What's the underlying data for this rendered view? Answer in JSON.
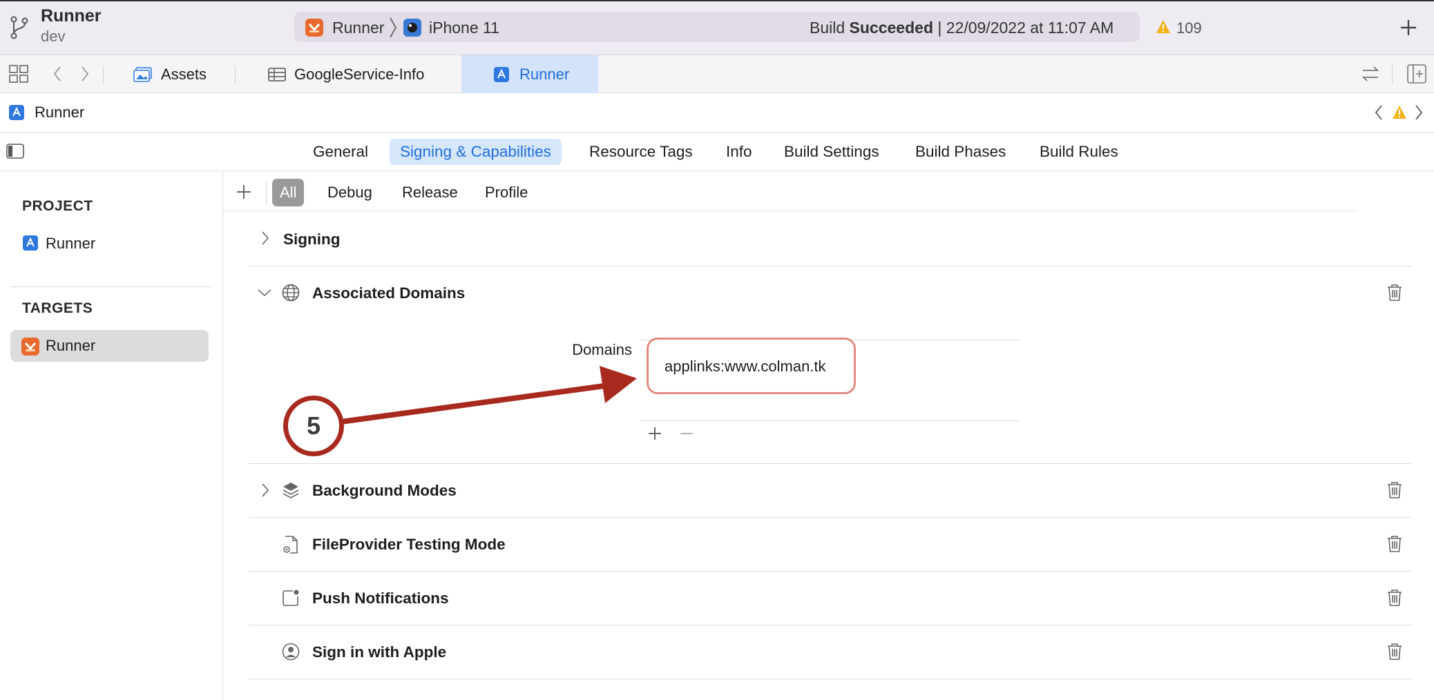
{
  "toolbar": {
    "project_name": "Runner",
    "branch": "dev",
    "scheme": "Runner",
    "device": "iPhone 11",
    "build_prefix": "Build",
    "build_status": "Succeeded",
    "build_time": "| 22/09/2022 at 11:07 AM",
    "warning_count": "109"
  },
  "tabs": [
    {
      "label": "Assets",
      "icon": "photo-assets-icon"
    },
    {
      "label": "GoogleService-Info",
      "icon": "table-plist-icon"
    },
    {
      "label": "Runner",
      "icon": "xcode-project-icon",
      "active": true
    }
  ],
  "jumpbar": {
    "label": "Runner"
  },
  "editor_tabs": [
    {
      "label": "General"
    },
    {
      "label": "Signing & Capabilities",
      "active": true
    },
    {
      "label": "Resource Tags"
    },
    {
      "label": "Info"
    },
    {
      "label": "Build Settings"
    },
    {
      "label": "Build Phases"
    },
    {
      "label": "Build Rules"
    }
  ],
  "sidebar": {
    "project_header": "PROJECT",
    "project_item": "Runner",
    "targets_header": "TARGETS",
    "target_item": "Runner"
  },
  "filters": [
    {
      "label": "All",
      "active": true
    },
    {
      "label": "Debug"
    },
    {
      "label": "Release"
    },
    {
      "label": "Profile"
    }
  ],
  "capabilities": {
    "signing": "Signing",
    "associated_domains": "Associated Domains",
    "domains_label": "Domains",
    "domain_value": "applinks:www.colman.tk",
    "background_modes": "Background Modes",
    "fileprovider": "FileProvider Testing Mode",
    "push": "Push Notifications",
    "apple_signin": "Sign in with Apple"
  },
  "annotation": {
    "step": "5"
  },
  "colors": {
    "accent": "#1f6fdc",
    "annotation_red": "#a82a1f",
    "highlight_box": "#e08a80",
    "warning": "#f2b31b"
  }
}
